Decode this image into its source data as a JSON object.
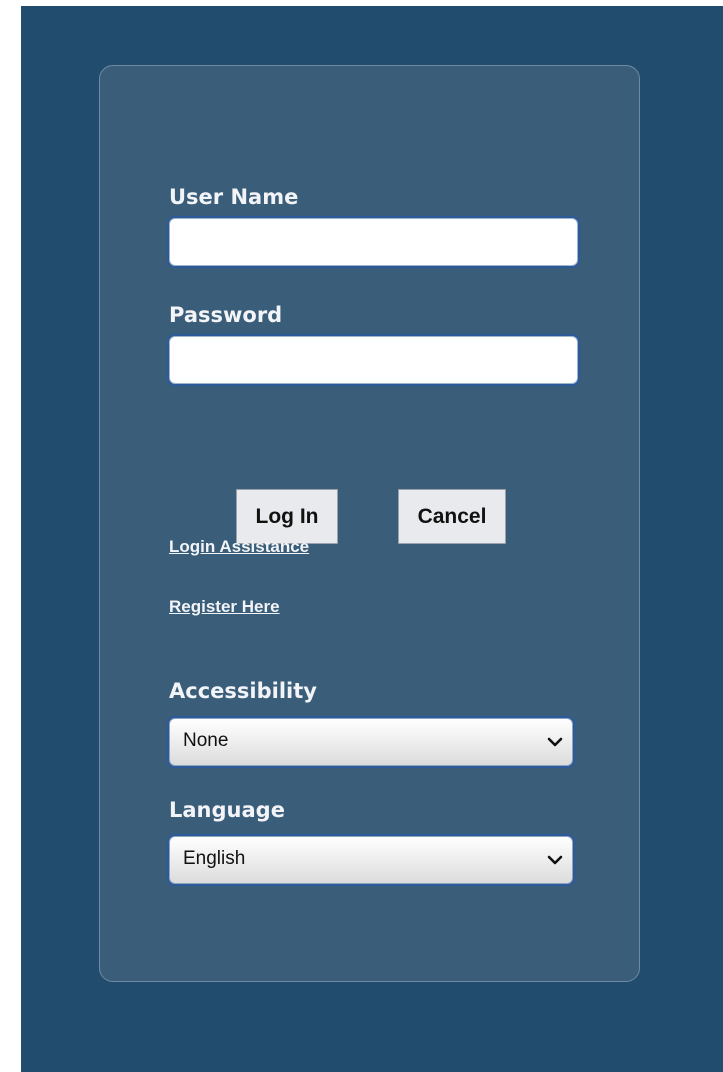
{
  "login_form": {
    "username_label": "User Name",
    "username_value": "",
    "password_label": "Password",
    "password_value": "",
    "login_button": "Log In",
    "cancel_button": "Cancel",
    "login_assistance_link": "Login Assistance",
    "register_link": "Register Here",
    "accessibility_label": "Accessibility",
    "accessibility_selected": "None",
    "language_label": "Language",
    "language_selected": "English"
  },
  "icons": {
    "dropdown": "chevron-down-icon"
  },
  "colors": {
    "background": "#224c6e",
    "panel": "#3a5d7a",
    "text": "#f2f4f7",
    "button": "#e8eaed"
  }
}
